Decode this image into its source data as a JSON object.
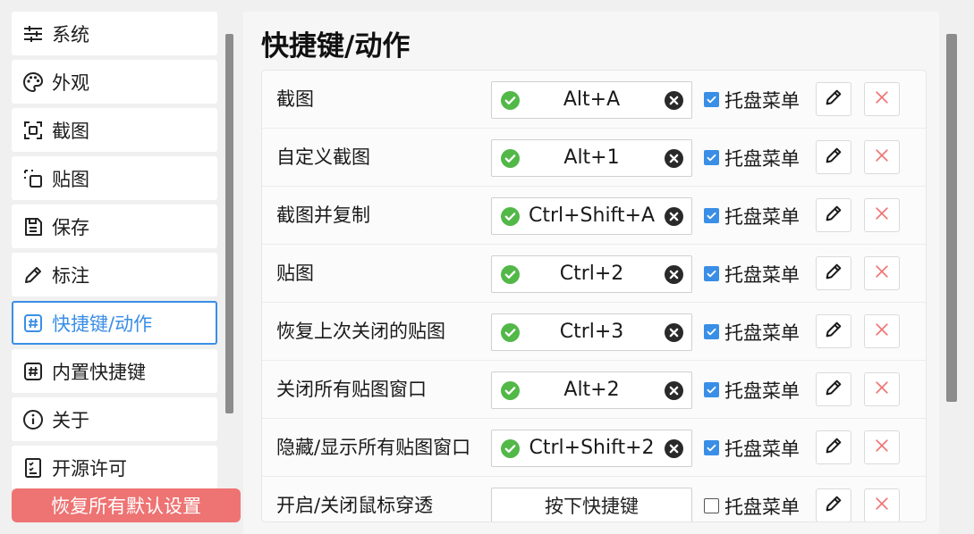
{
  "sidebar": {
    "items": [
      {
        "label": "系统",
        "icon": "sliders-icon",
        "name": "sidebar-item-system"
      },
      {
        "label": "外观",
        "icon": "palette-icon",
        "name": "sidebar-item-appearance"
      },
      {
        "label": "截图",
        "icon": "screenshot-icon",
        "name": "sidebar-item-screenshot"
      },
      {
        "label": "贴图",
        "icon": "pin-image-icon",
        "name": "sidebar-item-pin"
      },
      {
        "label": "保存",
        "icon": "save-icon",
        "name": "sidebar-item-save"
      },
      {
        "label": "标注",
        "icon": "pencil-icon",
        "name": "sidebar-item-annotate"
      },
      {
        "label": "快捷键/动作",
        "icon": "hash-icon",
        "name": "sidebar-item-shortcuts",
        "active": true
      },
      {
        "label": "内置快捷键",
        "icon": "hash-icon",
        "name": "sidebar-item-builtin-shortcuts"
      },
      {
        "label": "关于",
        "icon": "info-icon",
        "name": "sidebar-item-about"
      },
      {
        "label": "开源许可",
        "icon": "license-icon",
        "name": "sidebar-item-license"
      }
    ],
    "reset_label": "恢复所有默认设置"
  },
  "main": {
    "title": "快捷键/动作",
    "rows": [
      {
        "label": "截图",
        "key": "Alt+A",
        "status": "ok",
        "tray_checked": true,
        "tray_label": "托盘菜单"
      },
      {
        "label": "自定义截图",
        "key": "Alt+1",
        "status": "ok",
        "tray_checked": true,
        "tray_label": "托盘菜单"
      },
      {
        "label": "截图并复制",
        "key": "Ctrl+Shift+A",
        "status": "ok",
        "tray_checked": true,
        "tray_label": "托盘菜单"
      },
      {
        "label": "贴图",
        "key": "Ctrl+2",
        "status": "ok",
        "tray_checked": true,
        "tray_label": "托盘菜单"
      },
      {
        "label": "恢复上次关闭的贴图",
        "key": "Ctrl+3",
        "status": "ok",
        "tray_checked": true,
        "tray_label": "托盘菜单"
      },
      {
        "label": "关闭所有贴图窗口",
        "key": "Alt+2",
        "status": "ok",
        "tray_checked": true,
        "tray_label": "托盘菜单"
      },
      {
        "label": "隐藏/显示所有贴图窗口",
        "key": "Ctrl+Shift+2",
        "status": "ok",
        "tray_checked": true,
        "tray_label": "托盘菜单"
      },
      {
        "label": "开启/关闭鼠标穿透",
        "key": "按下快捷键",
        "status": "unset",
        "tray_checked": false,
        "tray_label": "托盘菜单"
      }
    ]
  },
  "colors": {
    "accent": "#3a8ee6",
    "ok": "#52b848",
    "danger": "#ee7373",
    "delete_icon": "#f07070"
  }
}
